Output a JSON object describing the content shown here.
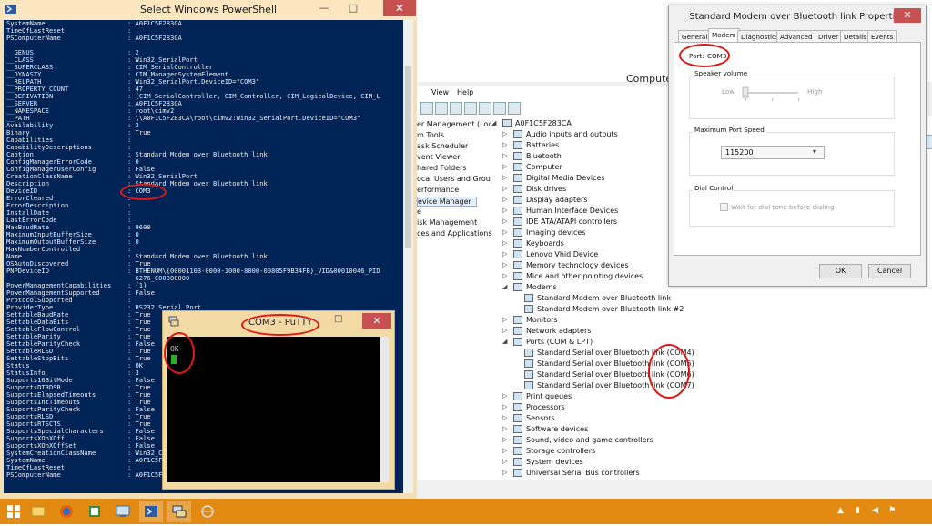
{
  "powershell": {
    "title": "Select Windows PowerShell",
    "lines": [
      {
        "k": "SystemName",
        "v": ": A0F1C5F283CA"
      },
      {
        "k": "TimeOfLastReset",
        "v": ":"
      },
      {
        "k": "PSComputerName",
        "v": ": A0F1C5F283CA"
      },
      {
        "k": "",
        "v": ""
      },
      {
        "k": "__GENUS",
        "v": ": 2"
      },
      {
        "k": "__CLASS",
        "v": ": Win32_SerialPort"
      },
      {
        "k": "__SUPERCLASS",
        "v": ": CIM_SerialController"
      },
      {
        "k": "__DYNASTY",
        "v": ": CIM_ManagedSystemElement"
      },
      {
        "k": "__RELPATH",
        "v": ": Win32_SerialPort.DeviceID=\"COM3\""
      },
      {
        "k": "__PROPERTY_COUNT",
        "v": ": 47"
      },
      {
        "k": "__DERIVATION",
        "v": ": {CIM_SerialController, CIM_Controller, CIM_LogicalDevice, CIM_L"
      },
      {
        "k": "__SERVER",
        "v": ": A0F1C5F283CA"
      },
      {
        "k": "__NAMESPACE",
        "v": ": root\\cimv2"
      },
      {
        "k": "__PATH",
        "v": ": \\\\A0F1C5F283CA\\root\\cimv2:Win32_SerialPort.DeviceID=\"COM3\""
      },
      {
        "k": "Availability",
        "v": ": 2"
      },
      {
        "k": "Binary",
        "v": ": True"
      },
      {
        "k": "Capabilities",
        "v": ":"
      },
      {
        "k": "CapabilityDescriptions",
        "v": ":"
      },
      {
        "k": "Caption",
        "v": ": Standard Modem over Bluetooth link"
      },
      {
        "k": "ConfigManagerErrorCode",
        "v": ": 0"
      },
      {
        "k": "ConfigManagerUserConfig",
        "v": ": False"
      },
      {
        "k": "CreationClassName",
        "v": ": Win32_SerialPort"
      },
      {
        "k": "Description",
        "v": ": Standard Modem over Bluetooth link"
      },
      {
        "k": "DeviceID",
        "v": ": COM3"
      },
      {
        "k": "ErrorCleared",
        "v": ":"
      },
      {
        "k": "ErrorDescription",
        "v": ":"
      },
      {
        "k": "InstallDate",
        "v": ":"
      },
      {
        "k": "LastErrorCode",
        "v": ":"
      },
      {
        "k": "MaxBaudRate",
        "v": ": 9600"
      },
      {
        "k": "MaximumInputBufferSize",
        "v": ": 0"
      },
      {
        "k": "MaximumOutputBufferSize",
        "v": ": 0"
      },
      {
        "k": "MaxNumberControlled",
        "v": ":"
      },
      {
        "k": "Name",
        "v": ": Standard Modem over Bluetooth link"
      },
      {
        "k": "OSAutoDiscovered",
        "v": ": True"
      },
      {
        "k": "PNPDeviceID",
        "v": ": BTHENUM\\{00001103-0000-1000-8000-00805F9B34FB}_VID&00010046_PID"
      },
      {
        "k": "",
        "v": "  6276_C00000000"
      },
      {
        "k": "PowerManagementCapabilities",
        "v": ": {1}"
      },
      {
        "k": "PowerManagementSupported",
        "v": ": False"
      },
      {
        "k": "ProtocolSupported",
        "v": ":"
      },
      {
        "k": "ProviderType",
        "v": ": RS232 Serial Port"
      },
      {
        "k": "SettableBaudRate",
        "v": ": True"
      },
      {
        "k": "SettableDataBits",
        "v": ": True"
      },
      {
        "k": "SettableFlowControl",
        "v": ": True"
      },
      {
        "k": "SettableParity",
        "v": ": True"
      },
      {
        "k": "SettableParityCheck",
        "v": ": False"
      },
      {
        "k": "SettableRLSD",
        "v": ": True"
      },
      {
        "k": "SettableStopBits",
        "v": ": True"
      },
      {
        "k": "Status",
        "v": ": OK"
      },
      {
        "k": "StatusInfo",
        "v": ": 3"
      },
      {
        "k": "Supports16BitMode",
        "v": ": False"
      },
      {
        "k": "SupportsDTRDSR",
        "v": ": True"
      },
      {
        "k": "SupportsElapsedTimeouts",
        "v": ": True"
      },
      {
        "k": "SupportsIntTimeouts",
        "v": ": True"
      },
      {
        "k": "SupportsParityCheck",
        "v": ": False"
      },
      {
        "k": "SupportsRLSD",
        "v": ": True"
      },
      {
        "k": "SupportsRTSCTS",
        "v": ": True"
      },
      {
        "k": "SupportsSpecialCharacters",
        "v": ": False"
      },
      {
        "k": "SupportsXOnXOff",
        "v": ": False"
      },
      {
        "k": "SupportsXOnXOffSet",
        "v": ": False"
      },
      {
        "k": "SystemCreationClassName",
        "v": ": Win32_ComputerSystem"
      },
      {
        "k": "SystemName",
        "v": ": A0F1C5F283CA"
      },
      {
        "k": "TimeOfLastReset",
        "v": ":"
      },
      {
        "k": "PSComputerName",
        "v": ": A0F1C5F283CA"
      }
    ]
  },
  "putty": {
    "title": "COM3 - PuTTY",
    "output": "OK"
  },
  "computer_management": {
    "title": "Computer",
    "menu": [
      "View",
      "Help"
    ],
    "left_pane": [
      "er Management (Local",
      "m Tools",
      "ask Scheduler",
      "vent Viewer",
      "hared Folders",
      "ocal Users and Groups",
      "erformance",
      "evice Manager",
      "e",
      "isk Management",
      "ces and Applications"
    ],
    "action_button": "er",
    "tree": [
      {
        "label": "A0F1C5F283CA",
        "level": 0,
        "exp": "◢"
      },
      {
        "label": "Audio inputs and outputs",
        "level": 1,
        "exp": "▷"
      },
      {
        "label": "Batteries",
        "level": 1,
        "exp": "▷"
      },
      {
        "label": "Bluetooth",
        "level": 1,
        "exp": "▷"
      },
      {
        "label": "Computer",
        "level": 1,
        "exp": "▷"
      },
      {
        "label": "Digital Media Devices",
        "level": 1,
        "exp": "▷"
      },
      {
        "label": "Disk drives",
        "level": 1,
        "exp": "▷"
      },
      {
        "label": "Display adapters",
        "level": 1,
        "exp": "▷"
      },
      {
        "label": "Human Interface Devices",
        "level": 1,
        "exp": "▷"
      },
      {
        "label": "IDE ATA/ATAPI controllers",
        "level": 1,
        "exp": "▷"
      },
      {
        "label": "Imaging devices",
        "level": 1,
        "exp": "▷"
      },
      {
        "label": "Keyboards",
        "level": 1,
        "exp": "▷"
      },
      {
        "label": "Lenovo Vhid Device",
        "level": 1,
        "exp": "▷"
      },
      {
        "label": "Memory technology devices",
        "level": 1,
        "exp": "▷"
      },
      {
        "label": "Mice and other pointing devices",
        "level": 1,
        "exp": "▷"
      },
      {
        "label": "Modems",
        "level": 1,
        "exp": "◢"
      },
      {
        "label": "Standard Modem over Bluetooth link",
        "level": 2,
        "exp": ""
      },
      {
        "label": "Standard Modem over Bluetooth link #2",
        "level": 2,
        "exp": ""
      },
      {
        "label": "Monitors",
        "level": 1,
        "exp": "▷"
      },
      {
        "label": "Network adapters",
        "level": 1,
        "exp": "▷"
      },
      {
        "label": "Ports (COM & LPT)",
        "level": 1,
        "exp": "◢"
      },
      {
        "label": "Standard Serial over Bluetooth link (COM4)",
        "level": 2,
        "exp": ""
      },
      {
        "label": "Standard Serial over Bluetooth link (COM5)",
        "level": 2,
        "exp": ""
      },
      {
        "label": "Standard Serial over Bluetooth link (COM6)",
        "level": 2,
        "exp": ""
      },
      {
        "label": "Standard Serial over Bluetooth link (COM7)",
        "level": 2,
        "exp": ""
      },
      {
        "label": "Print queues",
        "level": 1,
        "exp": "▷"
      },
      {
        "label": "Processors",
        "level": 1,
        "exp": "▷"
      },
      {
        "label": "Sensors",
        "level": 1,
        "exp": "▷"
      },
      {
        "label": "Software devices",
        "level": 1,
        "exp": "▷"
      },
      {
        "label": "Sound, video and game controllers",
        "level": 1,
        "exp": "▷"
      },
      {
        "label": "Storage controllers",
        "level": 1,
        "exp": "▷"
      },
      {
        "label": "System devices",
        "level": 1,
        "exp": "▷"
      },
      {
        "label": "Universal Serial Bus controllers",
        "level": 1,
        "exp": "▷"
      }
    ]
  },
  "properties": {
    "title": "Standard Modem over Bluetooth link Properties",
    "tabs": [
      "General",
      "Modem",
      "Diagnostics",
      "Advanced",
      "Driver",
      "Details",
      "Events"
    ],
    "active_tab": "Modem",
    "port_label": "Port:",
    "port_value": "COM3",
    "speaker_volume_label": "Speaker volume",
    "low_label": "Low",
    "high_label": "High",
    "speaker_volume_level": 0,
    "max_port_speed_label": "Maximum Port Speed",
    "max_port_speed_value": "115200",
    "dial_control_label": "Dial Control",
    "wait_dial_tone_label": "Wait for dial tone before dialing",
    "wait_dial_tone_checked": false,
    "ok_label": "OK",
    "cancel_label": "Cancel"
  },
  "annotation_color": "#e01818",
  "taskbar": {
    "color": "#e28a12",
    "icons": [
      "file-explorer-icon",
      "firefox-icon",
      "store-icon",
      "remote-desktop-icon",
      "powershell-icon",
      "network-icon",
      "putty-icon"
    ]
  }
}
